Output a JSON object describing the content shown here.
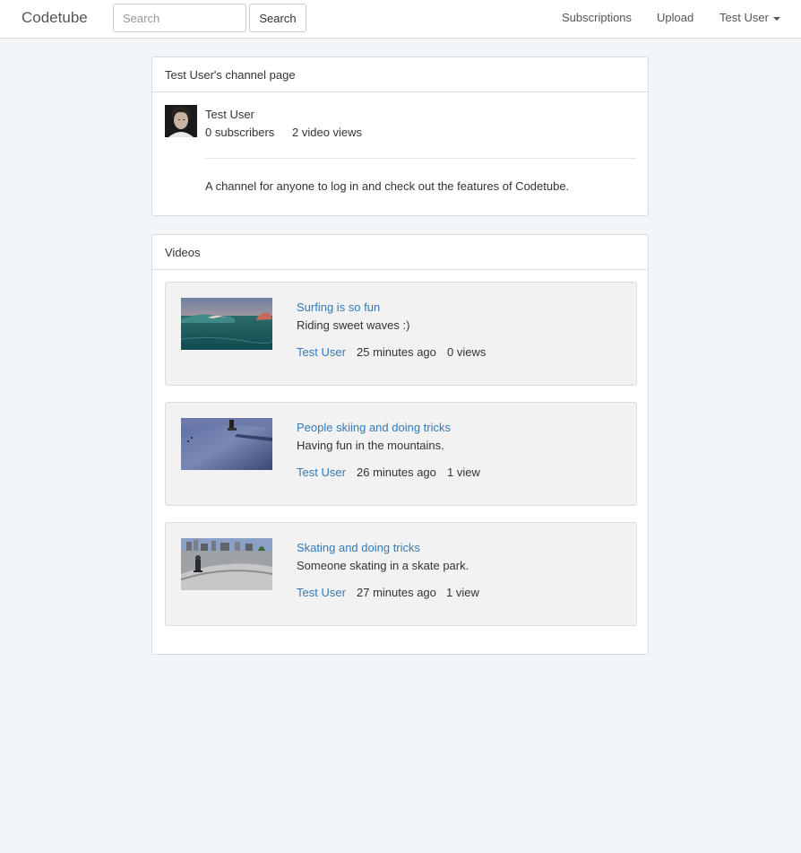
{
  "navbar": {
    "brand": "Codetube",
    "search_placeholder": "Search",
    "search_button": "Search",
    "subscriptions": "Subscriptions",
    "upload": "Upload",
    "user": "Test User"
  },
  "channel": {
    "heading": "Test User's channel page",
    "name": "Test User",
    "subscribers": "0 subscribers",
    "video_views": "2 video views",
    "description": "A channel for anyone to log in and check out the features of Codetube."
  },
  "videos": {
    "heading": "Videos",
    "items": [
      {
        "title": "Surfing is so fun",
        "description": "Riding sweet waves :)",
        "author": "Test User",
        "time": "25 minutes ago",
        "views": "0 views",
        "thumbnail": "surfing-wave"
      },
      {
        "title": "People skiing and doing tricks",
        "description": "Having fun in the mountains.",
        "author": "Test User",
        "time": "26 minutes ago",
        "views": "1 view",
        "thumbnail": "skiing-snow"
      },
      {
        "title": "Skating and doing tricks",
        "description": "Someone skating in a skate park.",
        "author": "Test User",
        "time": "27 minutes ago",
        "views": "1 view",
        "thumbnail": "skate-park"
      }
    ]
  },
  "colors": {
    "link": "#337ab7",
    "background": "#f3f6f9",
    "card": "#f2f2f2"
  }
}
